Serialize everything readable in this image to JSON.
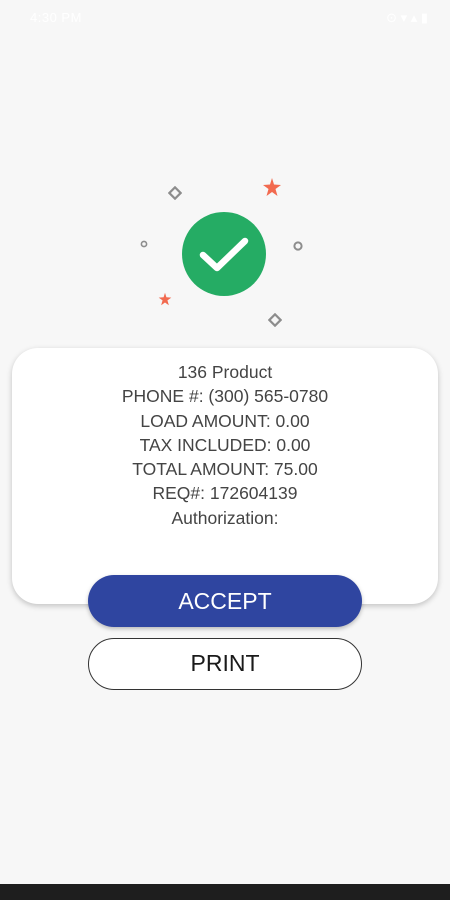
{
  "status_bar": {
    "time": "4:30 PM",
    "icons": "⊙ ▾ ▴ ▮"
  },
  "colors": {
    "success": "#25ac64",
    "accent_button": "#2f45a0",
    "sparkle": "#f26a4f",
    "decoration_gray": "#8d8d8d"
  },
  "icons": {
    "success": "checkmark-icon"
  },
  "receipt": {
    "product": "136 Product",
    "phone": "PHONE #: (300) 565-0780",
    "load_amount": "LOAD AMOUNT: 0.00",
    "tax_included": "TAX INCLUDED: 0.00",
    "total_amount": "TOTAL AMOUNT: 75.00",
    "req": "REQ#: 172604139",
    "authorization": "Authorization:"
  },
  "actions": {
    "accept_label": "ACCEPT",
    "print_label": "PRINT"
  }
}
